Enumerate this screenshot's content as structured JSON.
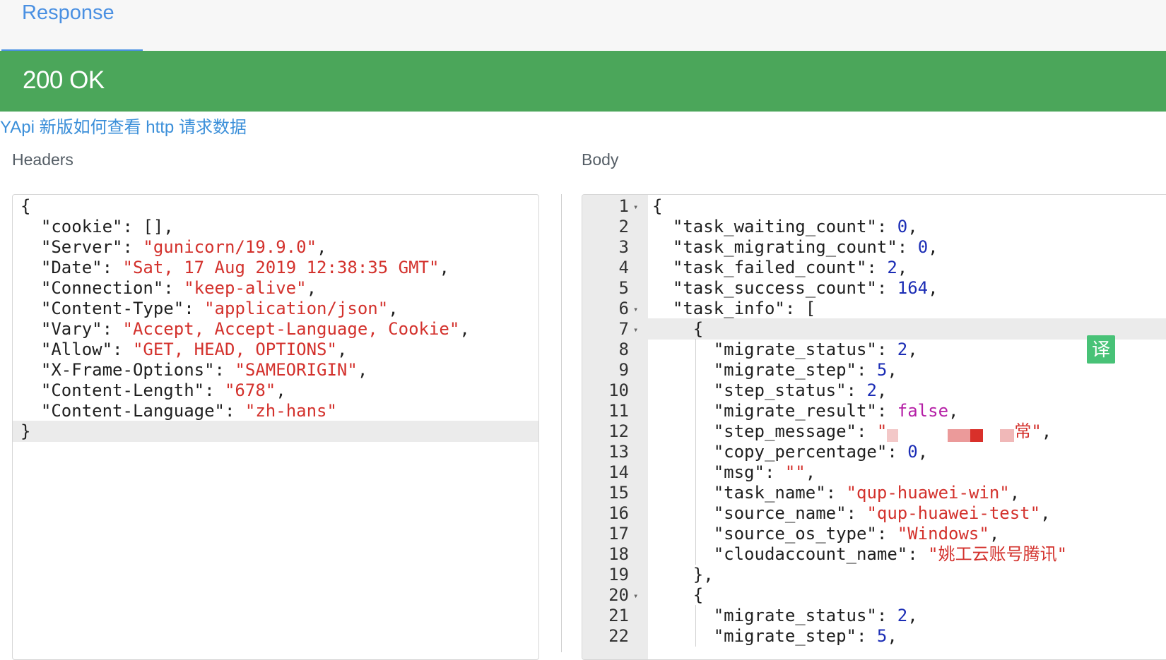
{
  "tab": {
    "label": "Response"
  },
  "status": {
    "text": "200 OK"
  },
  "help_link": "YApi 新版如何查看 http 请求数据",
  "headers_label": "Headers",
  "body_label": "Body",
  "headers_lines": [
    [
      {
        "t": "k",
        "v": "{"
      }
    ],
    [
      {
        "t": "k",
        "v": "  \"cookie\": [],"
      }
    ],
    [
      {
        "t": "k",
        "v": "  \"Server\": "
      },
      {
        "t": "s",
        "v": "\"gunicorn/19.9.0\""
      },
      {
        "t": "k",
        "v": ","
      }
    ],
    [
      {
        "t": "k",
        "v": "  \"Date\": "
      },
      {
        "t": "s",
        "v": "\"Sat, 17 Aug 2019 12:38:35 GMT\""
      },
      {
        "t": "k",
        "v": ","
      }
    ],
    [
      {
        "t": "k",
        "v": "  \"Connection\": "
      },
      {
        "t": "s",
        "v": "\"keep-alive\""
      },
      {
        "t": "k",
        "v": ","
      }
    ],
    [
      {
        "t": "k",
        "v": "  \"Content-Type\": "
      },
      {
        "t": "s",
        "v": "\"application/json\""
      },
      {
        "t": "k",
        "v": ","
      }
    ],
    [
      {
        "t": "k",
        "v": "  \"Vary\": "
      },
      {
        "t": "s",
        "v": "\"Accept, Accept-Language, Cookie\""
      },
      {
        "t": "k",
        "v": ","
      }
    ],
    [
      {
        "t": "k",
        "v": "  \"Allow\": "
      },
      {
        "t": "s",
        "v": "\"GET, HEAD, OPTIONS\""
      },
      {
        "t": "k",
        "v": ","
      }
    ],
    [
      {
        "t": "k",
        "v": "  \"X-Frame-Options\": "
      },
      {
        "t": "s",
        "v": "\"SAMEORIGIN\""
      },
      {
        "t": "k",
        "v": ","
      }
    ],
    [
      {
        "t": "k",
        "v": "  \"Content-Length\": "
      },
      {
        "t": "s",
        "v": "\"678\""
      },
      {
        "t": "k",
        "v": ","
      }
    ],
    [
      {
        "t": "k",
        "v": "  \"Content-Language\": "
      },
      {
        "t": "s",
        "v": "\"zh-hans\""
      }
    ],
    [
      {
        "t": "k",
        "v": "}"
      }
    ]
  ],
  "headers_active_line": 12,
  "body_lines": [
    {
      "n": "1",
      "fold": true,
      "parts": [
        {
          "t": "k",
          "v": "{"
        }
      ]
    },
    {
      "n": "2",
      "parts": [
        {
          "t": "k",
          "v": "  \"task_waiting_count\": "
        },
        {
          "t": "n",
          "v": "0"
        },
        {
          "t": "k",
          "v": ","
        }
      ]
    },
    {
      "n": "3",
      "parts": [
        {
          "t": "k",
          "v": "  \"task_migrating_count\": "
        },
        {
          "t": "n",
          "v": "0"
        },
        {
          "t": "k",
          "v": ","
        }
      ]
    },
    {
      "n": "4",
      "parts": [
        {
          "t": "k",
          "v": "  \"task_failed_count\": "
        },
        {
          "t": "n",
          "v": "2"
        },
        {
          "t": "k",
          "v": ","
        }
      ]
    },
    {
      "n": "5",
      "parts": [
        {
          "t": "k",
          "v": "  \"task_success_count\": "
        },
        {
          "t": "n",
          "v": "164"
        },
        {
          "t": "k",
          "v": ","
        }
      ]
    },
    {
      "n": "6",
      "fold": true,
      "parts": [
        {
          "t": "k",
          "v": "  \"task_info\": ["
        }
      ]
    },
    {
      "n": "7",
      "fold": true,
      "active": true,
      "parts": [
        {
          "t": "k",
          "v": "    {"
        }
      ]
    },
    {
      "n": "8",
      "parts": [
        {
          "t": "k",
          "v": "      \"migrate_status\": "
        },
        {
          "t": "n",
          "v": "2"
        },
        {
          "t": "k",
          "v": ","
        }
      ]
    },
    {
      "n": "9",
      "parts": [
        {
          "t": "k",
          "v": "      \"migrate_step\": "
        },
        {
          "t": "n",
          "v": "5"
        },
        {
          "t": "k",
          "v": ","
        }
      ]
    },
    {
      "n": "10",
      "parts": [
        {
          "t": "k",
          "v": "      \"step_status\": "
        },
        {
          "t": "n",
          "v": "2"
        },
        {
          "t": "k",
          "v": ","
        }
      ]
    },
    {
      "n": "11",
      "parts": [
        {
          "t": "k",
          "v": "      \"migrate_result\": "
        },
        {
          "t": "b",
          "v": "false"
        },
        {
          "t": "k",
          "v": ","
        }
      ]
    },
    {
      "n": "12",
      "parts": [
        {
          "t": "k",
          "v": "      \"step_message\": "
        },
        {
          "t": "s",
          "v": "\""
        },
        {
          "t": "blur",
          "v": ""
        },
        {
          "t": "s",
          "v": "常\""
        },
        {
          "t": "k",
          "v": ","
        }
      ]
    },
    {
      "n": "13",
      "parts": [
        {
          "t": "k",
          "v": "      \"copy_percentage\": "
        },
        {
          "t": "n",
          "v": "0"
        },
        {
          "t": "k",
          "v": ","
        }
      ]
    },
    {
      "n": "14",
      "parts": [
        {
          "t": "k",
          "v": "      \"msg\": "
        },
        {
          "t": "s",
          "v": "\"\""
        },
        {
          "t": "k",
          "v": ","
        }
      ]
    },
    {
      "n": "15",
      "parts": [
        {
          "t": "k",
          "v": "      \"task_name\": "
        },
        {
          "t": "s",
          "v": "\"qup-huawei-win\""
        },
        {
          "t": "k",
          "v": ","
        }
      ]
    },
    {
      "n": "16",
      "parts": [
        {
          "t": "k",
          "v": "      \"source_name\": "
        },
        {
          "t": "s",
          "v": "\"qup-huawei-test\""
        },
        {
          "t": "k",
          "v": ","
        }
      ]
    },
    {
      "n": "17",
      "parts": [
        {
          "t": "k",
          "v": "      \"source_os_type\": "
        },
        {
          "t": "s",
          "v": "\"Windows\""
        },
        {
          "t": "k",
          "v": ","
        }
      ]
    },
    {
      "n": "18",
      "parts": [
        {
          "t": "k",
          "v": "      \"cloudaccount_name\": "
        },
        {
          "t": "s",
          "v": "\"姚工云账号腾讯\""
        }
      ]
    },
    {
      "n": "19",
      "parts": [
        {
          "t": "k",
          "v": "    },"
        }
      ]
    },
    {
      "n": "20",
      "fold": true,
      "parts": [
        {
          "t": "k",
          "v": "    {"
        }
      ]
    },
    {
      "n": "21",
      "parts": [
        {
          "t": "k",
          "v": "      \"migrate_status\": "
        },
        {
          "t": "n",
          "v": "2"
        },
        {
          "t": "k",
          "v": ","
        }
      ]
    },
    {
      "n": "22",
      "parts": [
        {
          "t": "k",
          "v": "      \"migrate_step\": "
        },
        {
          "t": "n",
          "v": "5"
        },
        {
          "t": "k",
          "v": ","
        }
      ]
    }
  ],
  "translate_button": "译",
  "colors": {
    "accent": "#4a90e2",
    "status_bg": "#4ba65a",
    "string": "#d3312c",
    "number": "#1b2db5",
    "boolean": "#b51fa6"
  }
}
